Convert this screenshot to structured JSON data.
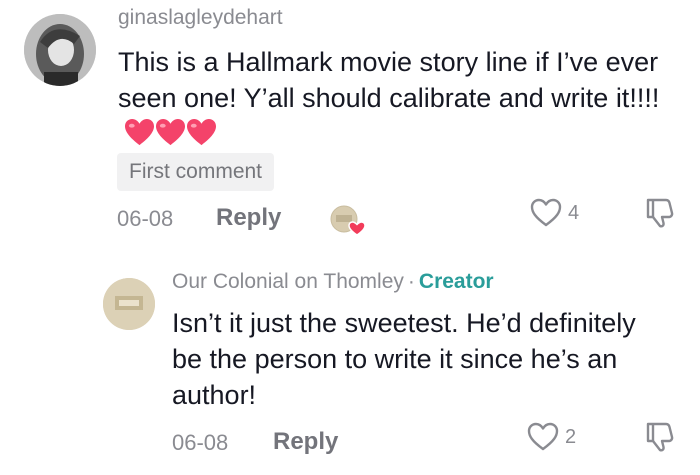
{
  "comment": {
    "username": "ginaslagleydehart",
    "text": "This is a Hallmark movie story line if I’ve ever seen one! Y’all should calibrate and write it!!!!",
    "emoji_count": 3,
    "badge": "First comment",
    "date": "06-08",
    "reply_label": "Reply",
    "like_count": "4",
    "heart_color": "#f23c5a",
    "creator_liked": true
  },
  "reply": {
    "username": "Our Colonial on Thomley",
    "separator": "·",
    "creator_label": "Creator",
    "text": "Isn’t it just the sweetest. He’d definitely be the person to write it since he’s an author!",
    "date": "06-08",
    "reply_label": "Reply",
    "like_count": "2",
    "creator_color": "#2a9d9a"
  }
}
